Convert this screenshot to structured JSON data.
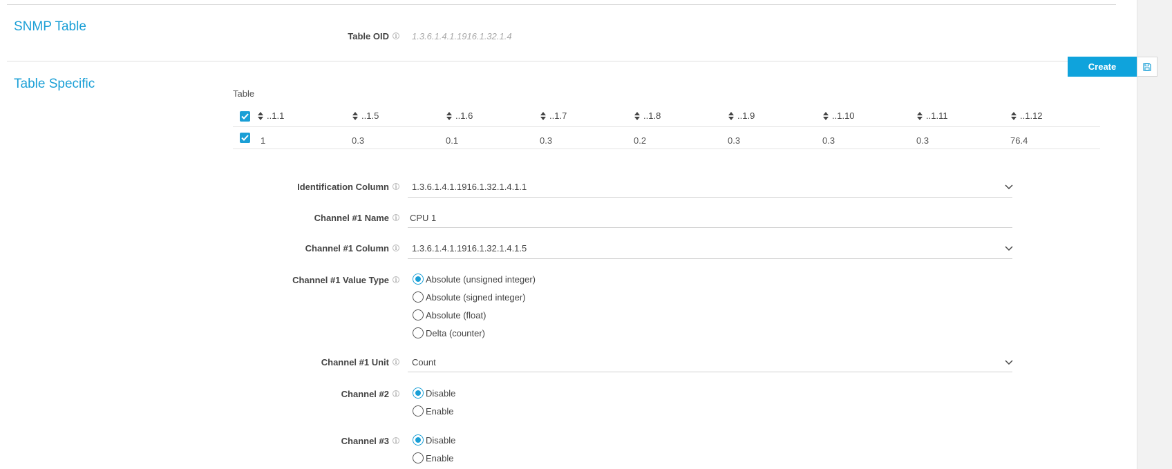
{
  "sections": {
    "snmp_table": "SNMP Table",
    "table_specific": "Table Specific"
  },
  "table_oid": {
    "label": "Table OID",
    "value": "1.3.6.1.4.1.1916.1.32.1.4"
  },
  "toolbar": {
    "create_label": "Create",
    "save_icon": "floppy-disk-icon"
  },
  "table": {
    "caption": "Table",
    "columns": [
      "..1.1",
      "..1.5",
      "..1.6",
      "..1.7",
      "..1.8",
      "..1.9",
      "..1.10",
      "..1.11",
      "..1.12"
    ],
    "rows": [
      [
        "1",
        "0.3",
        "0.1",
        "0.3",
        "0.2",
        "0.3",
        "0.3",
        "0.3",
        "76.4"
      ]
    ]
  },
  "form": {
    "identification_column": {
      "label": "Identification Column",
      "value": "1.3.6.1.4.1.1916.1.32.1.4.1.1"
    },
    "channel1_name": {
      "label": "Channel #1 Name",
      "value": "CPU 1"
    },
    "channel1_column": {
      "label": "Channel #1 Column",
      "value": "1.3.6.1.4.1.1916.1.32.1.4.1.5"
    },
    "channel1_value_type": {
      "label": "Channel #1 Value Type",
      "options": [
        "Absolute (unsigned integer)",
        "Absolute (signed integer)",
        "Absolute (float)",
        "Delta (counter)"
      ],
      "selected": 0
    },
    "channel1_unit": {
      "label": "Channel #1 Unit",
      "value": "Count"
    },
    "channel2": {
      "label": "Channel #2",
      "options": [
        "Disable",
        "Enable"
      ],
      "selected": 0
    },
    "channel3": {
      "label": "Channel #3",
      "options": [
        "Disable",
        "Enable"
      ],
      "selected": 0
    }
  },
  "colors": {
    "accent": "#1a9fd6",
    "button": "#0fa3dc"
  }
}
